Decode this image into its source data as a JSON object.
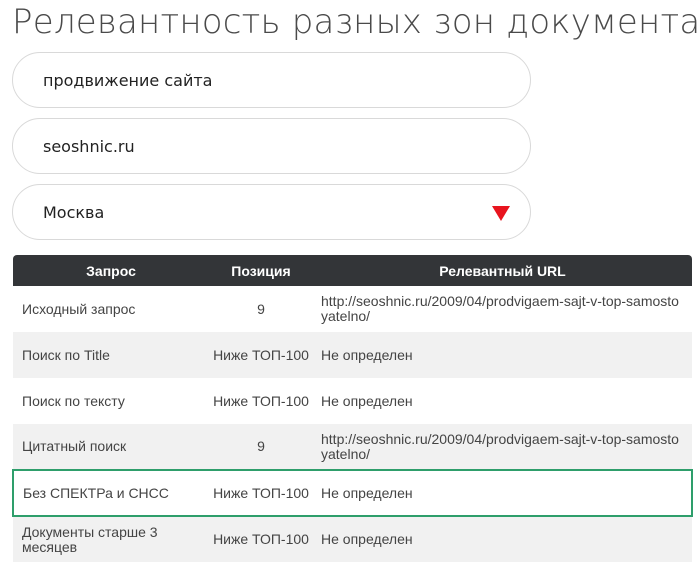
{
  "page": {
    "title": "Релевантность разных зон документа"
  },
  "form": {
    "query_value": "продвижение сайта",
    "site_value": "seoshnic.ru",
    "region_value": "Москва",
    "dropdown_icon": "triangle-down-icon",
    "accent_color": "#e8141e"
  },
  "table": {
    "headers": {
      "query": "Запрос",
      "position": "Позиция",
      "url": "Релевантный URL"
    },
    "header_color": "#333538",
    "highlight_color": "#2e9e6b",
    "rows": [
      {
        "query": "Исходный запрос",
        "position": "9",
        "url": "http://seoshnic.ru/2009/04/prodvigaem-sajt-v-top-samostoyatelno/"
      },
      {
        "query": "Поиск по Title",
        "position": "Ниже ТОП-100",
        "url": "Не определен"
      },
      {
        "query": "Поиск по тексту",
        "position": "Ниже ТОП-100",
        "url": "Не определен"
      },
      {
        "query": "Цитатный поиск",
        "position": "9",
        "url": "http://seoshnic.ru/2009/04/prodvigaem-sajt-v-top-samostoyatelno/"
      },
      {
        "query": "Без СПЕКТРа и СНСС",
        "position": "Ниже ТОП-100",
        "url": "Не определен",
        "highlighted": true
      },
      {
        "query": "Документы старше 3 месяцев",
        "position": "Ниже ТОП-100",
        "url": "Не определен"
      }
    ]
  }
}
